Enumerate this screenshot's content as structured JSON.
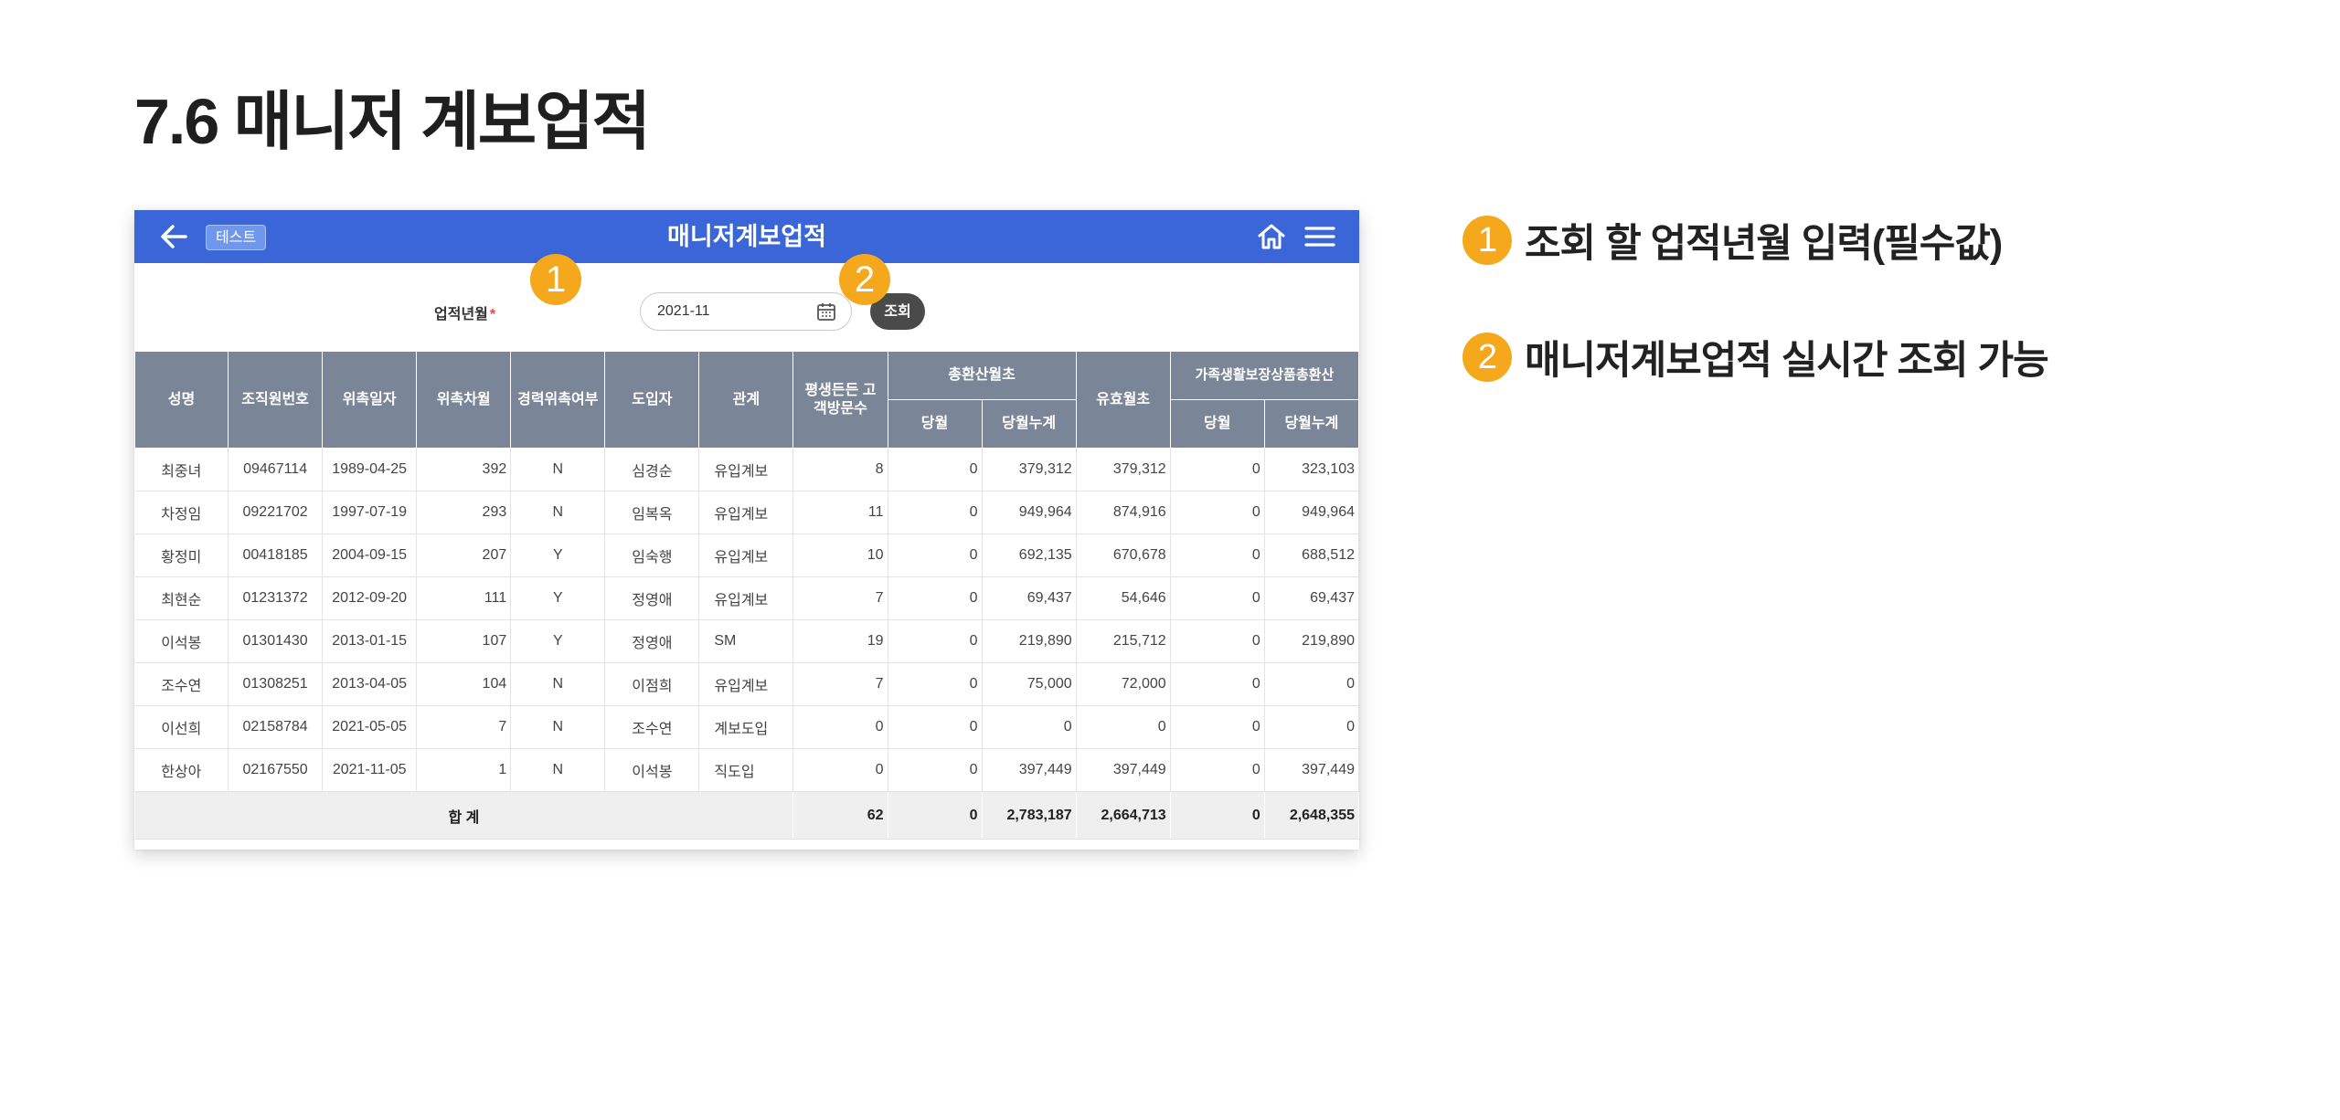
{
  "page_title": "7.6 매니저 계보업적",
  "app": {
    "test_badge": "테스트",
    "title": "매니저계보업적"
  },
  "search": {
    "label": "업적년월",
    "required_mark": "*",
    "value": "2021-11",
    "button": "조회"
  },
  "markers": [
    "1",
    "2"
  ],
  "table": {
    "headers": {
      "name": "성명",
      "org_no": "조직원번호",
      "commission_date": "위촉일자",
      "commission_order": "위촉차월",
      "career_commission": "경력위촉여부",
      "introducer": "도입자",
      "relation": "관계",
      "avg_visits": "평생든든 고객방문수",
      "total_premium": "총환산월초",
      "valid_premium": "유효월초",
      "family_premium": "가족생활보장상품총환산",
      "sub_month": "당월",
      "sub_cumulative": "당월누계"
    },
    "rows": [
      [
        "최중녀",
        "09467114",
        "1989-04-25",
        "392",
        "N",
        "심경순",
        "유입계보",
        "8",
        "0",
        "379,312",
        "379,312",
        "0",
        "323,103"
      ],
      [
        "차정임",
        "09221702",
        "1997-07-19",
        "293",
        "N",
        "임복옥",
        "유입계보",
        "11",
        "0",
        "949,964",
        "874,916",
        "0",
        "949,964"
      ],
      [
        "황정미",
        "00418185",
        "2004-09-15",
        "207",
        "Y",
        "임숙행",
        "유입계보",
        "10",
        "0",
        "692,135",
        "670,678",
        "0",
        "688,512"
      ],
      [
        "최현순",
        "01231372",
        "2012-09-20",
        "111",
        "Y",
        "정영애",
        "유입계보",
        "7",
        "0",
        "69,437",
        "54,646",
        "0",
        "69,437"
      ],
      [
        "이석봉",
        "01301430",
        "2013-01-15",
        "107",
        "Y",
        "정영애",
        "SM",
        "19",
        "0",
        "219,890",
        "215,712",
        "0",
        "219,890"
      ],
      [
        "조수연",
        "01308251",
        "2013-04-05",
        "104",
        "N",
        "이점희",
        "유입계보",
        "7",
        "0",
        "75,000",
        "72,000",
        "0",
        "0"
      ],
      [
        "이선희",
        "02158784",
        "2021-05-05",
        "7",
        "N",
        "조수연",
        "계보도입",
        "0",
        "0",
        "0",
        "0",
        "0",
        "0"
      ],
      [
        "한상아",
        "02167550",
        "2021-11-05",
        "1",
        "N",
        "이석봉",
        "직도입",
        "0",
        "0",
        "397,449",
        "397,449",
        "0",
        "397,449"
      ]
    ],
    "total": {
      "label": "합 계",
      "avg_visits": "62",
      "total_month": "0",
      "total_cumulative": "2,783,187",
      "valid": "2,664,713",
      "family_month": "0",
      "family_cumulative": "2,648,355"
    }
  },
  "notes": [
    {
      "num": "1",
      "text": "조회 할 업적년월 입력(필수값)"
    },
    {
      "num": "2",
      "text": "매니저계보업적 실시간 조회 가능"
    }
  ],
  "colors": {
    "appbar": "#3a66d8",
    "header": "#7a8698",
    "marker": "#f5a81c",
    "search_button": "#4a4a4a"
  }
}
